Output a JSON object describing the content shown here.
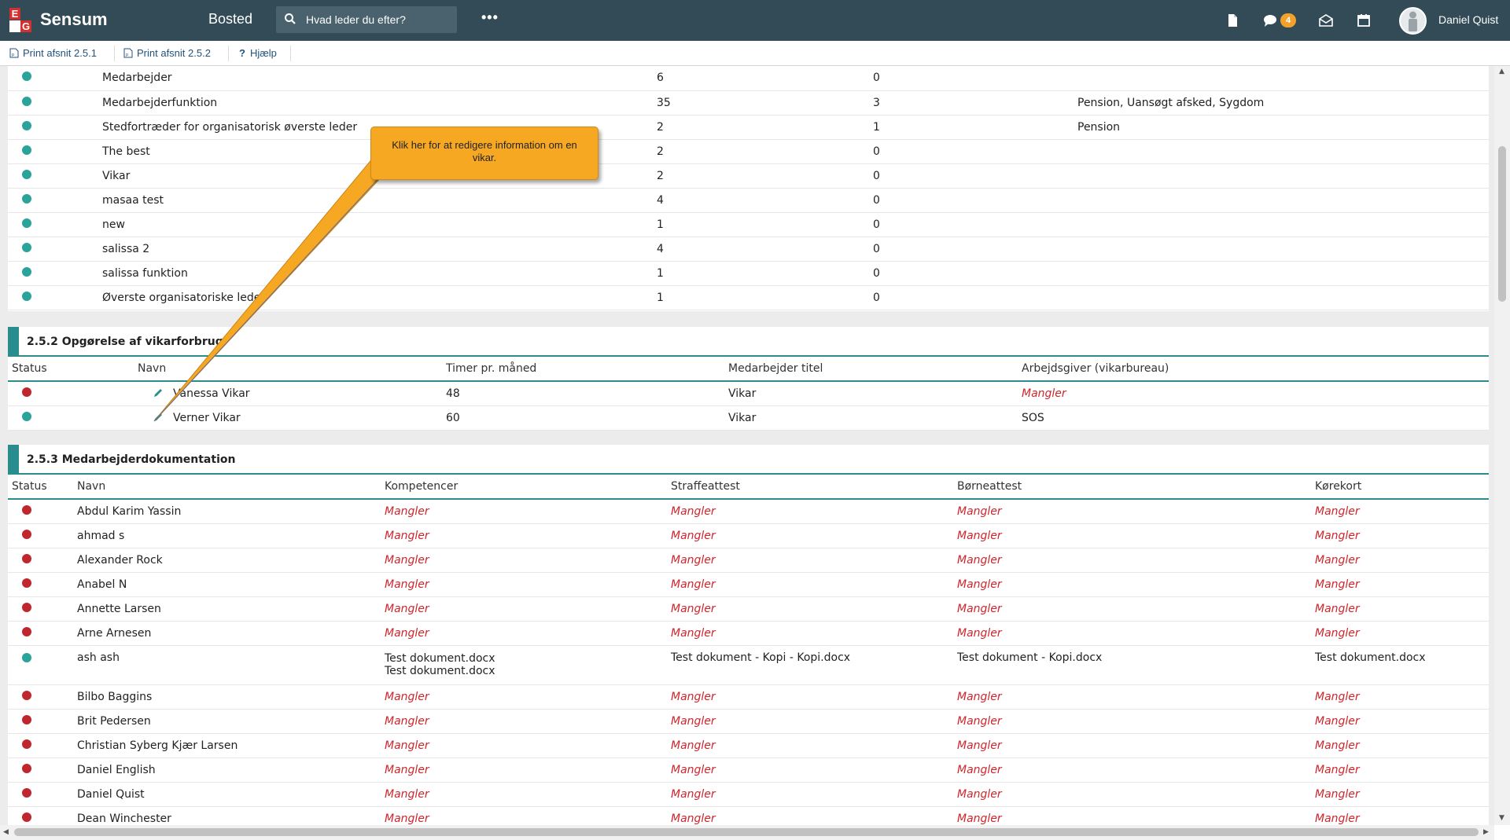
{
  "header": {
    "brand": "Sensum",
    "module": "Bosted",
    "search_placeholder": "Hvad leder du efter?",
    "more_label": "•••",
    "messages_count": "4",
    "user_name": "Daniel Quist"
  },
  "toolbar": {
    "print_251": "Print afsnit 2.5.1",
    "print_252": "Print afsnit 2.5.2",
    "help": "Hjælp"
  },
  "section_251": {
    "rows": [
      {
        "status": "ok",
        "name": "Medarbejder",
        "count": "6",
        "left": "0",
        "reasons": ""
      },
      {
        "status": "ok",
        "name": "Medarbejderfunktion",
        "count": "35",
        "left": "3",
        "reasons": "Pension, Uansøgt afsked, Sygdom"
      },
      {
        "status": "ok",
        "name": "Stedfortræder for organisatorisk øverste leder",
        "count": "2",
        "left": "1",
        "reasons": "Pension"
      },
      {
        "status": "ok",
        "name": "The best",
        "count": "2",
        "left": "0",
        "reasons": ""
      },
      {
        "status": "ok",
        "name": "Vikar",
        "count": "2",
        "left": "0",
        "reasons": ""
      },
      {
        "status": "ok",
        "name": "masaa test",
        "count": "4",
        "left": "0",
        "reasons": ""
      },
      {
        "status": "ok",
        "name": "new",
        "count": "1",
        "left": "0",
        "reasons": ""
      },
      {
        "status": "ok",
        "name": "salissa 2",
        "count": "4",
        "left": "0",
        "reasons": ""
      },
      {
        "status": "ok",
        "name": "salissa funktion",
        "count": "1",
        "left": "0",
        "reasons": ""
      },
      {
        "status": "ok",
        "name": "Øverste organisatoriske leder",
        "count": "1",
        "left": "0",
        "reasons": ""
      }
    ]
  },
  "section_252": {
    "title": "2.5.2 Opgørelse af vikarforbrug",
    "columns": [
      "Status",
      "Navn",
      "Timer pr. måned",
      "Medarbejder titel",
      "Arbejdsgiver (vikarbureau)"
    ],
    "rows": [
      {
        "status": "bad",
        "name": "Vanessa Vikar",
        "hours": "48",
        "title": "Vikar",
        "employer": "Mangler"
      },
      {
        "status": "ok",
        "name": "Verner Vikar",
        "hours": "60",
        "title": "Vikar",
        "employer": "SOS"
      }
    ]
  },
  "section_253": {
    "title": "2.5.3 Medarbejderdokumentation",
    "columns": [
      "Status",
      "Navn",
      "Kompetencer",
      "Straffeattest",
      "Børneattest",
      "Kørekort"
    ],
    "missing": "Mangler",
    "rows": [
      {
        "status": "bad",
        "name": "Abdul Karim Yassin"
      },
      {
        "status": "bad",
        "name": "ahmad s"
      },
      {
        "status": "bad",
        "name": "Alexander Rock"
      },
      {
        "status": "bad",
        "name": "Anabel N"
      },
      {
        "status": "bad",
        "name": "Annette Larsen"
      },
      {
        "status": "bad",
        "name": "Arne Arnesen"
      },
      {
        "status": "ok",
        "name": "ash ash",
        "kompetencer": [
          "Test dokument.docx",
          "Test dokument.docx"
        ],
        "straffeattest": "Test dokument - Kopi - Kopi.docx",
        "borneattest": "Test dokument - Kopi.docx",
        "korekort": "Test dokument.docx"
      },
      {
        "status": "bad",
        "name": "Bilbo Baggins"
      },
      {
        "status": "bad",
        "name": "Brit Pedersen"
      },
      {
        "status": "bad",
        "name": "Christian Syberg Kjær Larsen"
      },
      {
        "status": "bad",
        "name": "Daniel English"
      },
      {
        "status": "bad",
        "name": "Daniel Quist"
      },
      {
        "status": "bad",
        "name": "Dean Winchester"
      }
    ]
  },
  "callout": {
    "text": "Klik her for at redigere information om en vikar."
  },
  "colors": {
    "topbar": "#324b56",
    "accent": "#2a8d8d",
    "status_ok": "#2aa39a",
    "status_bad": "#c0262d",
    "missing_text": "#d0242b",
    "callout": "#f6a823"
  }
}
